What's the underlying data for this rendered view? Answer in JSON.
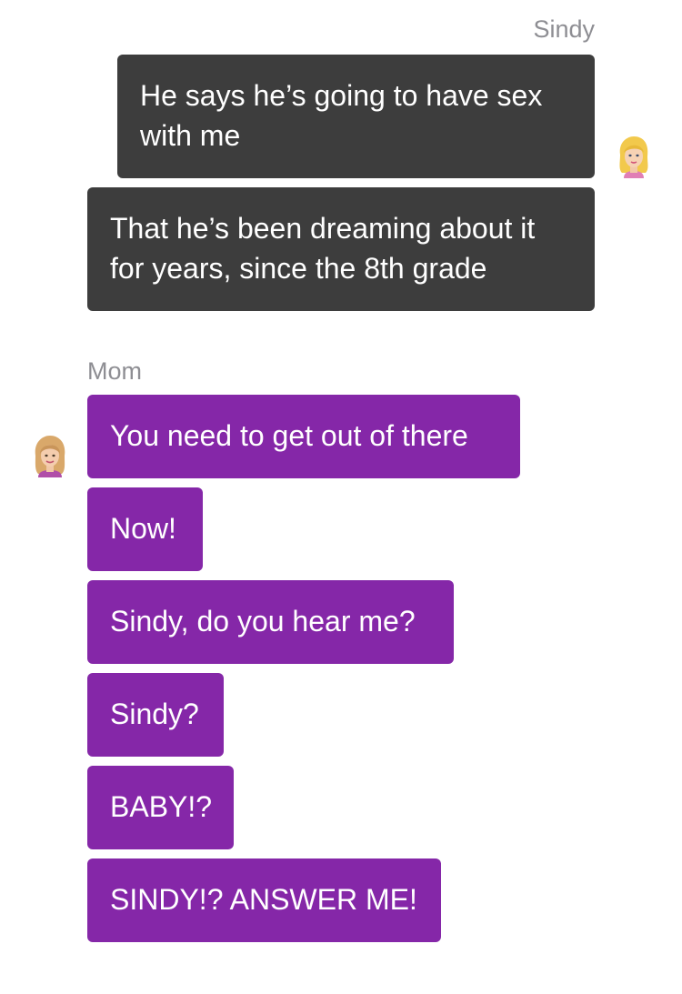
{
  "conversation": {
    "groups": [
      {
        "sender": "Sindy",
        "side": "right",
        "messages": [
          "He says he’s going to have sex with me",
          "That he’s been dreaming about it for years, since the 8th grade"
        ]
      },
      {
        "sender": "Mom",
        "side": "left",
        "messages": [
          "You need to get out of there",
          "Now!",
          "Sindy, do you hear me?",
          "Sindy?",
          "BABY!?",
          "SINDY!? ANSWER ME!"
        ]
      }
    ]
  },
  "colors": {
    "sindy_bubble": "#3d3d3d",
    "mom_bubble": "#8527a8",
    "sender_label": "#8e8e93",
    "bubble_text": "#ffffff"
  },
  "icons": {
    "sindy_avatar": "blonde-girl-avatar-icon",
    "mom_avatar": "mom-avatar-icon"
  }
}
